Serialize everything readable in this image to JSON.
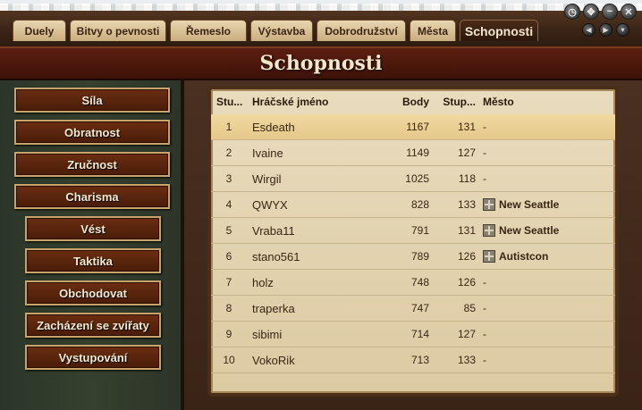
{
  "tabs": [
    {
      "label": "Duely",
      "active": false
    },
    {
      "label": "Bitvy o pevnosti",
      "active": false
    },
    {
      "label": "Řemeslo",
      "active": false
    },
    {
      "label": "Výstavba",
      "active": false
    },
    {
      "label": "Dobrodružství",
      "active": false
    },
    {
      "label": "Města",
      "active": false
    },
    {
      "label": "Schopnosti",
      "active": true
    }
  ],
  "title": "Schopnosti",
  "sidebar": {
    "items": [
      {
        "label": "Síla"
      },
      {
        "label": "Obratnost"
      },
      {
        "label": "Zručnost"
      },
      {
        "label": "Charisma"
      },
      {
        "label": "Vést"
      },
      {
        "label": "Taktika"
      },
      {
        "label": "Obchodovat"
      },
      {
        "label": "Zacházení se zvířaty"
      },
      {
        "label": "Vystupování"
      }
    ]
  },
  "table": {
    "headers": {
      "rank": "Stu...",
      "name": "Hráčské jméno",
      "points": "Body",
      "level": "Stup...",
      "city": "Město"
    },
    "rows": [
      {
        "rank": "1",
        "name": "Esdeath",
        "points": "1167",
        "level": "131",
        "city": "-",
        "has_city": false
      },
      {
        "rank": "2",
        "name": "Ivaine",
        "points": "1149",
        "level": "127",
        "city": "-",
        "has_city": false
      },
      {
        "rank": "3",
        "name": "Wirgil",
        "points": "1025",
        "level": "118",
        "city": "-",
        "has_city": false
      },
      {
        "rank": "4",
        "name": "QWYX",
        "points": "828",
        "level": "133",
        "city": "New Seattle",
        "has_city": true
      },
      {
        "rank": "5",
        "name": "Vraba11",
        "points": "791",
        "level": "131",
        "city": "New Seattle",
        "has_city": true
      },
      {
        "rank": "6",
        "name": "stano561",
        "points": "789",
        "level": "126",
        "city": "Autistcon",
        "has_city": true
      },
      {
        "rank": "7",
        "name": "holz",
        "points": "748",
        "level": "126",
        "city": "-",
        "has_city": false
      },
      {
        "rank": "8",
        "name": "traperka",
        "points": "747",
        "level": "85",
        "city": "-",
        "has_city": false
      },
      {
        "rank": "9",
        "name": "sibimi",
        "points": "714",
        "level": "127",
        "city": "-",
        "has_city": false
      },
      {
        "rank": "10",
        "name": "VokoRik",
        "points": "713",
        "level": "133",
        "city": "-",
        "has_city": false
      }
    ]
  }
}
